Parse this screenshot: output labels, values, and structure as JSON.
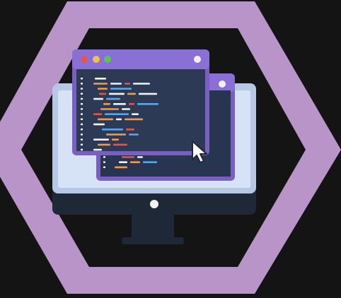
{
  "colors": {
    "background": "#141414",
    "hexagon": "#b894c9",
    "monitor_frame": "#1e2836",
    "monitor_screen_bezel": "#b7c8e6",
    "monitor_screen": "#d6e2f5",
    "window_frame": "#7a5fc0",
    "window_titlebar": "#8a6fd6",
    "window_body": "#2c3a56",
    "window_body_back": "#283550",
    "dot_red": "#e2574c",
    "dot_yellow": "#f0c24a",
    "dot_green": "#5bc35d",
    "code_orange": "#f29a4b",
    "code_white": "#f2f2f2",
    "code_blue": "#5aa7e6",
    "code_red": "#e2574c",
    "code_purple": "#a88ce0",
    "cursor": "#ffffff"
  },
  "icons": {
    "emblem": "hexagon-outline-icon",
    "monitor": "desktop-monitor-icon",
    "cursor": "mouse-pointer-icon",
    "code_window": "code-editor-window-icon"
  }
}
